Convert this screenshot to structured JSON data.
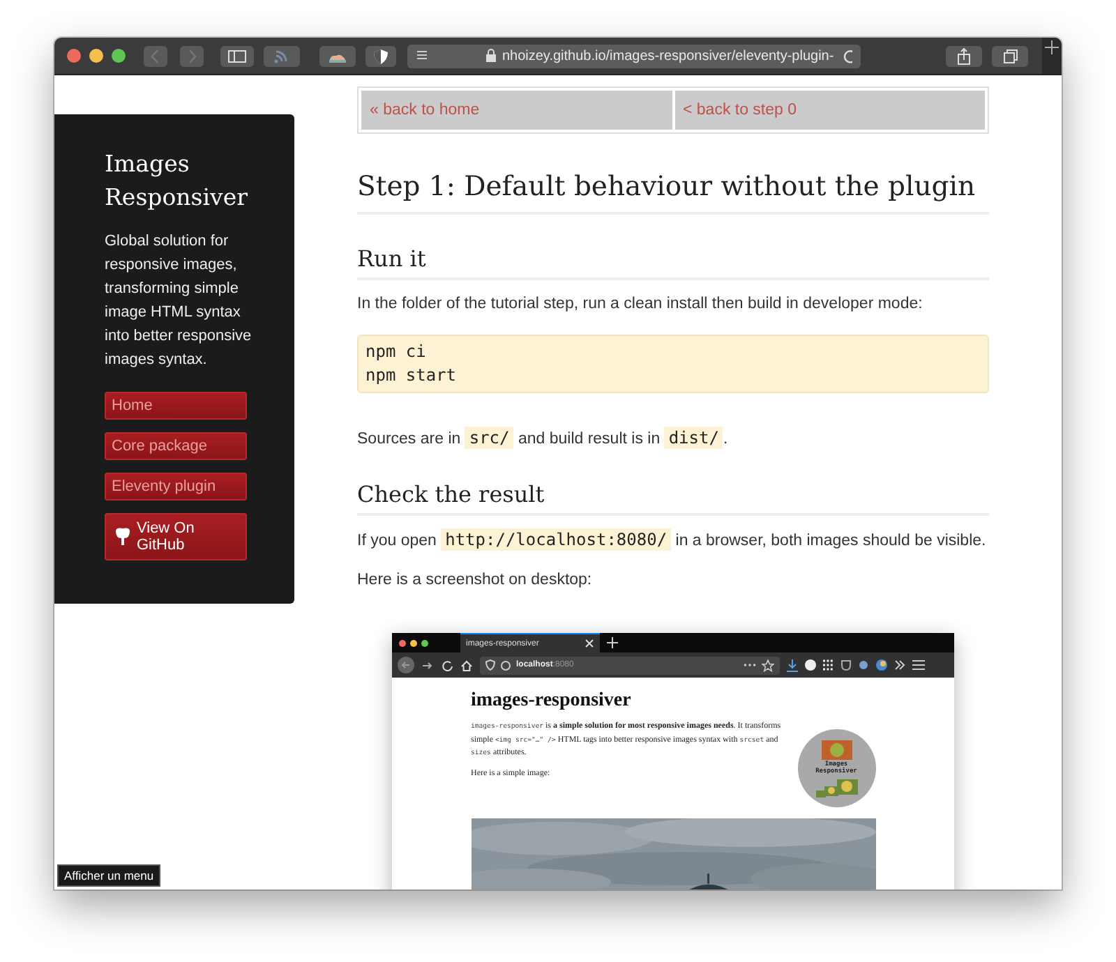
{
  "browser": {
    "url": "nhoizey.github.io/images-responsiver/eleventy-plugin-"
  },
  "sidebar": {
    "title": "Images Responsiver",
    "description": "Global solution for responsive images, transforming simple image HTML syntax into better responsive images syntax.",
    "nav": [
      {
        "label": "Home"
      },
      {
        "label": "Core package"
      },
      {
        "label": "Eleventy plugin"
      }
    ],
    "github_button": "View On GitHub"
  },
  "pager": [
    "« back to home",
    "< back to step 0"
  ],
  "article": [
    {
      "kind": "h1",
      "text": "Step 1: Default behaviour without the plugin"
    },
    {
      "kind": "h2",
      "text": "Run it"
    },
    {
      "kind": "p",
      "parts": [
        {
          "kind": "text",
          "text": "In the folder of the tutorial step, run a clean install then build in developer mode:"
        }
      ]
    },
    {
      "kind": "pre",
      "lines": [
        "npm ci",
        "npm start"
      ]
    },
    {
      "kind": "p",
      "parts": [
        {
          "kind": "text",
          "text": "Sources are in "
        },
        {
          "kind": "code",
          "text": "src/"
        },
        {
          "kind": "text",
          "text": " and build result is in "
        },
        {
          "kind": "code",
          "text": "dist/"
        },
        {
          "kind": "text",
          "text": "."
        }
      ]
    },
    {
      "kind": "h2",
      "text": "Check the result"
    },
    {
      "kind": "p",
      "parts": [
        {
          "kind": "text",
          "text": "If you open "
        },
        {
          "kind": "code",
          "text": "http://localhost:8080/"
        },
        {
          "kind": "text",
          "text": " in a browser, both images should be visible."
        }
      ]
    },
    {
      "kind": "p",
      "parts": [
        {
          "kind": "text",
          "text": "Here is a screenshot on desktop:"
        }
      ]
    }
  ],
  "screenshot": {
    "tab_title": "images-responsiver",
    "url_host": "localhost",
    "url_port": ":8080",
    "heading": "images-responsiver",
    "intro": [
      {
        "kind": "code",
        "text": "images-responsiver"
      },
      {
        "kind": "text",
        "text": " is "
      },
      {
        "kind": "bold",
        "text": "a simple solution for most responsive images needs"
      },
      {
        "kind": "text",
        "text": ". It transforms simple "
      },
      {
        "kind": "code",
        "text": "<img src=\"…\" />"
      },
      {
        "kind": "text",
        "text": " HTML tags into better responsive images syntax with "
      },
      {
        "kind": "code",
        "text": "srcset"
      },
      {
        "kind": "text",
        "text": " and "
      },
      {
        "kind": "code",
        "text": "sizes"
      },
      {
        "kind": "text",
        "text": " attributes."
      }
    ],
    "paragraph": "Here is a simple image:",
    "logo_text": "Images Responsiver"
  },
  "tooltip": "Afficher un menu"
}
